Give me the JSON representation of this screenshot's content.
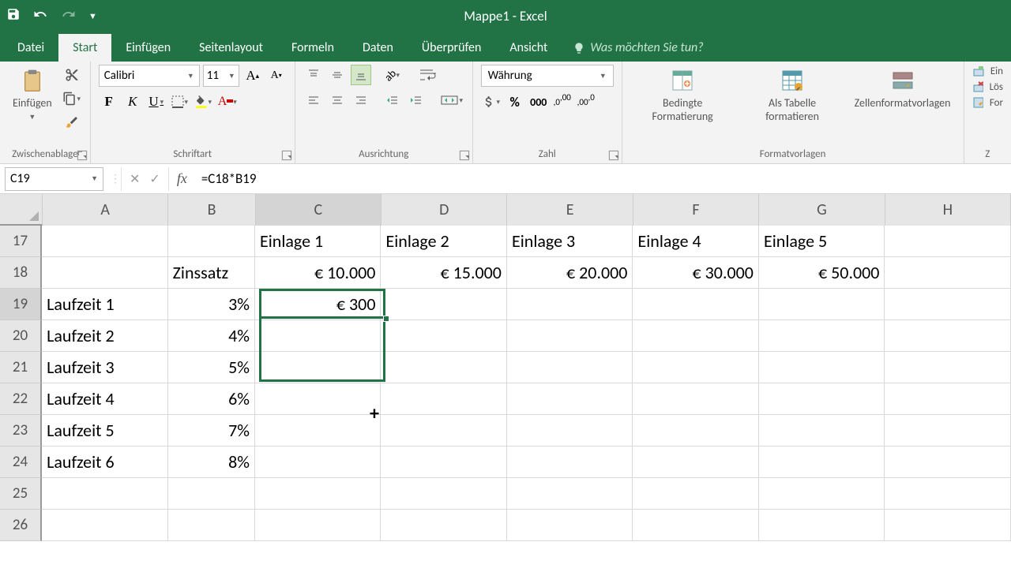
{
  "app": {
    "title": "Mappe1 - Excel"
  },
  "tabs": {
    "datei": "Datei",
    "start": "Start",
    "einfuegen": "Einfügen",
    "seitenlayout": "Seitenlayout",
    "formeln": "Formeln",
    "daten": "Daten",
    "ueberpruefen": "Überprüfen",
    "ansicht": "Ansicht",
    "tellme": "Was möchten Sie tun?"
  },
  "ribbon": {
    "paste": "Einfügen",
    "clipboardGroup": "Zwischenablage",
    "fontName": "Calibri",
    "fontSize": "11",
    "fontGroup": "Schriftart",
    "alignGroup": "Ausrichtung",
    "numFormat": "Währung",
    "numGroup": "Zahl",
    "condFormat": "Bedingte Formatierung",
    "formatTable": "Als Tabelle formatieren",
    "cellStyles": "Zellenformatvorlagen",
    "stylesGroup": "Formatvorlagen",
    "insertBtn": "Ein",
    "deleteBtn": "Lös",
    "formatBtn": "For",
    "cellsGroup": "Z"
  },
  "formula": {
    "nameBox": "C19",
    "value": "=C18*B19"
  },
  "columns": [
    "A",
    "B",
    "C",
    "D",
    "E",
    "F",
    "G",
    "H"
  ],
  "rowNums": [
    "17",
    "18",
    "19",
    "20",
    "21",
    "22",
    "23",
    "24",
    "25",
    "26"
  ],
  "cells": {
    "r17": {
      "C": "Einlage 1",
      "D": "Einlage 2",
      "E": "Einlage 3",
      "F": "Einlage 4",
      "G": "Einlage 5"
    },
    "r18": {
      "B": "Zinssatz",
      "C": "€ 10.000",
      "D": "€ 15.000",
      "E": "€ 20.000",
      "F": "€ 30.000",
      "G": "€ 50.000"
    },
    "r19": {
      "A": "Laufzeit 1",
      "B": "3%",
      "C": "€ 300"
    },
    "r20": {
      "A": "Laufzeit 2",
      "B": "4%"
    },
    "r21": {
      "A": "Laufzeit 3",
      "B": "5%"
    },
    "r22": {
      "A": "Laufzeit 4",
      "B": "6%"
    },
    "r23": {
      "A": "Laufzeit 5",
      "B": "7%"
    },
    "r24": {
      "A": "Laufzeit 6",
      "B": "8%"
    }
  }
}
